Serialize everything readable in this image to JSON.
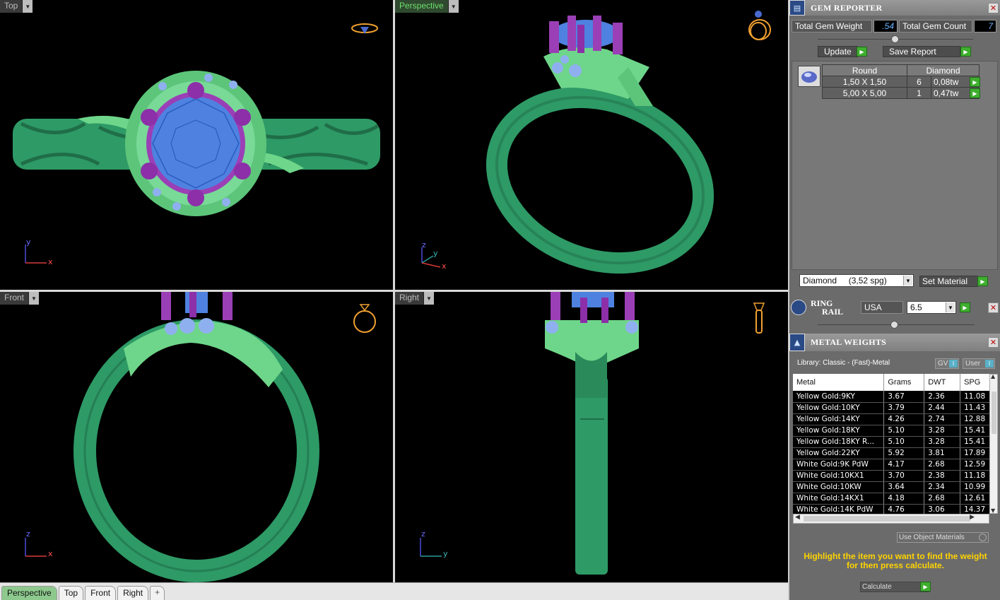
{
  "viewports": {
    "top": {
      "label": "Top"
    },
    "perspective": {
      "label": "Perspective"
    },
    "front": {
      "label": "Front"
    },
    "right": {
      "label": "Right"
    }
  },
  "axes": {
    "x": "x",
    "y": "y",
    "z": "z"
  },
  "tabs": [
    {
      "label": "Perspective",
      "active": true
    },
    {
      "label": "Top"
    },
    {
      "label": "Front"
    },
    {
      "label": "Right"
    },
    {
      "label": "+",
      "icon": "add-tab-icon"
    }
  ],
  "gem_reporter": {
    "title": "GEM REPORTER",
    "total_weight_label": "Total Gem Weight",
    "total_weight_value": ".54",
    "total_count_label": "Total Gem Count",
    "total_count_value": "7",
    "update_label": "Update",
    "save_report_label": "Save Report",
    "table_header": {
      "cut": "Round",
      "material": "Diamond"
    },
    "rows": [
      {
        "size": "1,50 X 1,50",
        "count": "6",
        "weight": "0,08tw"
      },
      {
        "size": "5,00 X 5,00",
        "count": "1",
        "weight": "0,47tw"
      }
    ],
    "material_select": "Diamond     (3,52 spg)",
    "set_material_label": "Set Material"
  },
  "ring_rail": {
    "title_line1": "RING",
    "title_line2": "RAIL",
    "region": "USA",
    "size": "6.5"
  },
  "metal_weights": {
    "title": "METAL WEIGHTS",
    "library": "Library: Classic - (Fast)-Metal",
    "gv_label": "GV",
    "user_label": "User",
    "columns": [
      "Metal",
      "Grams",
      "DWT",
      "SPG"
    ],
    "rows": [
      [
        "Yellow Gold:9KY",
        "3.67",
        "2.36",
        "11.08"
      ],
      [
        "Yellow Gold:10KY",
        "3.79",
        "2.44",
        "11.43"
      ],
      [
        "Yellow Gold:14KY",
        "4.26",
        "2.74",
        "12.88"
      ],
      [
        "Yellow Gold:18KY",
        "5.10",
        "3.28",
        "15.41"
      ],
      [
        "Yellow Gold:18KY R...",
        "5.10",
        "3.28",
        "15.41"
      ],
      [
        "Yellow Gold:22KY",
        "5.92",
        "3.81",
        "17.89"
      ],
      [
        "White Gold:9K PdW",
        "4.17",
        "2.68",
        "12.59"
      ],
      [
        "White Gold:10KX1",
        "3.70",
        "2.38",
        "11.18"
      ],
      [
        "White Gold:10KW",
        "3.64",
        "2.34",
        "10.99"
      ],
      [
        "White Gold:14KX1",
        "4.18",
        "2.68",
        "12.61"
      ],
      [
        "White Gold:14K PdW",
        "4.76",
        "3.06",
        "14.37"
      ]
    ],
    "use_object_materials": "Use Object Materials",
    "hint": "Highlight the item you want to find the weight for then press calculate.",
    "calculate_label": "Calculate"
  }
}
